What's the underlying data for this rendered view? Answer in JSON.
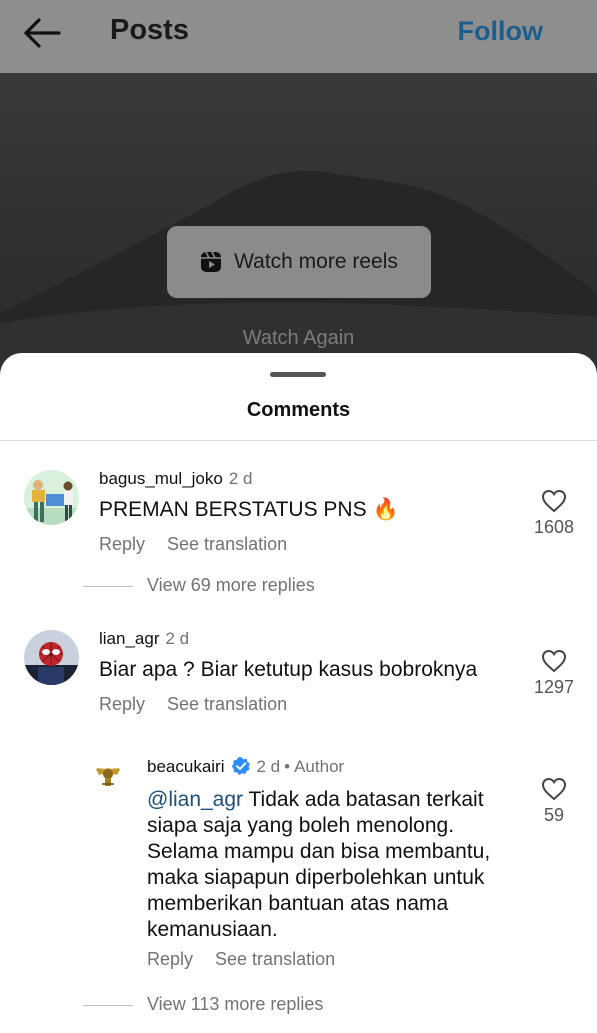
{
  "topbar": {
    "title": "Posts",
    "follow_label": "Follow"
  },
  "video": {
    "watch_more_label": "Watch more reels",
    "watch_again_label": "Watch Again"
  },
  "sheet": {
    "title": "Comments"
  },
  "comments": [
    {
      "username": "bagus_mul_joko",
      "time": "2 d",
      "text": "PREMAN BERSTATUS PNS",
      "emoji": "🔥",
      "reply_label": "Reply",
      "translate_label": "See translation",
      "likes": "1608",
      "view_replies": "View 69 more replies"
    },
    {
      "username": "lian_agr",
      "time": "2 d",
      "text": "Biar apa ? Biar ketutup kasus bobroknya",
      "reply_label": "Reply",
      "translate_label": "See translation",
      "likes": "1297"
    }
  ],
  "reply": {
    "username": "beacukairi",
    "time": "2 d",
    "author_label": "Author",
    "mention": "@lian_agr",
    "text": " Tidak ada batasan terkait siapa saja yang boleh menolong. Selama mampu dan bisa membantu, maka siapapun diperbolehkan untuk memberikan bantuan atas nama kemanusiaan.",
    "reply_label": "Reply",
    "translate_label": "See translation",
    "likes": "59",
    "view_replies": "View 113 more replies"
  },
  "colors": {
    "follow": "#1d5e8f",
    "verified": "#2f8cff",
    "mention": "#1d4f7a"
  }
}
